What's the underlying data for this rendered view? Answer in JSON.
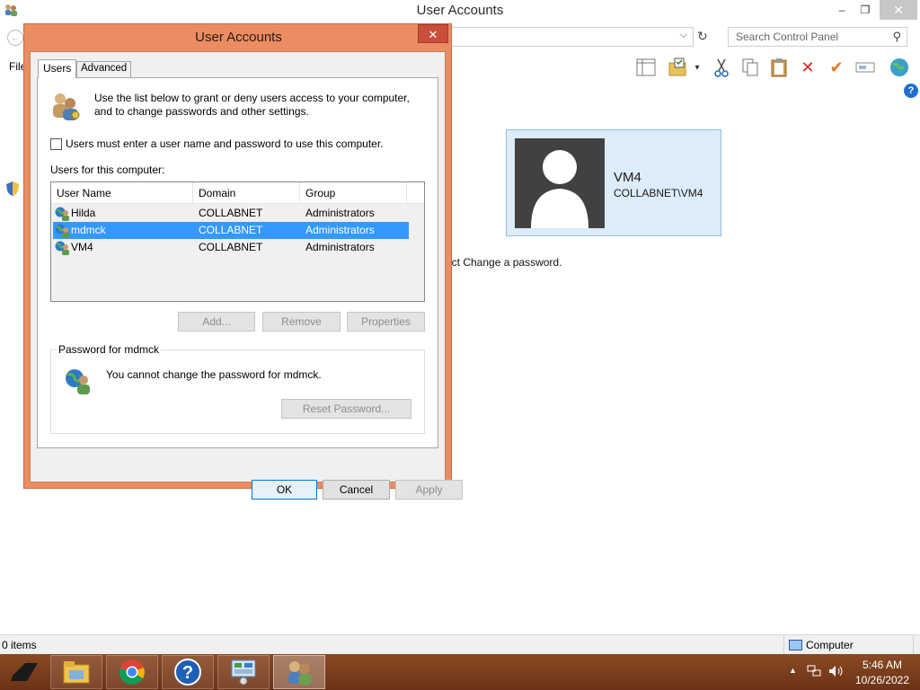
{
  "window": {
    "title": "User Accounts",
    "minimize": "–",
    "maximize": "❐",
    "close": "✕"
  },
  "search": {
    "placeholder": "Search Control Panel"
  },
  "menu": {
    "file": "File"
  },
  "toolbar": [
    "view-pane-icon",
    "folder-properties-icon",
    "cut-icon",
    "copy-icon",
    "paste-icon",
    "delete-icon",
    "check-icon",
    "rename-icon",
    "globe-icon"
  ],
  "user_card": {
    "name": "VM4",
    "domain": "COLLABNET\\VM4"
  },
  "hint": "ect Change a password.",
  "statusbar": {
    "items": "0 items",
    "location": "Computer"
  },
  "dialog": {
    "title": "User Accounts",
    "close": "✕",
    "tabs": {
      "users": "Users",
      "advanced": "Advanced"
    },
    "intro": "Use the list below to grant or deny users access to your computer, and to change passwords and other settings.",
    "must_login": "Users must enter a user name and password to use this computer.",
    "must_login_checked": false,
    "users_label": "Users for this computer:",
    "columns": {
      "name": "User Name",
      "domain": "Domain",
      "group": "Group"
    },
    "users": [
      {
        "name": "Hilda",
        "domain": "COLLABNET",
        "group": "Administrators",
        "selected": false
      },
      {
        "name": "mdmck",
        "domain": "COLLABNET",
        "group": "Administrators",
        "selected": true
      },
      {
        "name": "VM4",
        "domain": "COLLABNET",
        "group": "Administrators",
        "selected": false
      }
    ],
    "buttons": {
      "add": "Add...",
      "remove": "Remove",
      "properties": "Properties",
      "reset": "Reset Password...",
      "ok": "OK",
      "cancel": "Cancel",
      "apply": "Apply"
    },
    "password_group": "Password for mdmck",
    "password_message": "You cannot change the password for mdmck."
  },
  "taskbar": {
    "apps": [
      "file-explorer-icon",
      "chrome-icon",
      "help-icon",
      "control-panel-icon",
      "user-accounts-icon"
    ],
    "active_app": "user-accounts-icon",
    "time": "5:46 AM",
    "date": "10/26/2022"
  },
  "colors": {
    "dialog_frame": "#eb8c62",
    "taskbar": "#7a3c1c",
    "selection": "#3399ff",
    "user_card": "#dcecf9"
  }
}
